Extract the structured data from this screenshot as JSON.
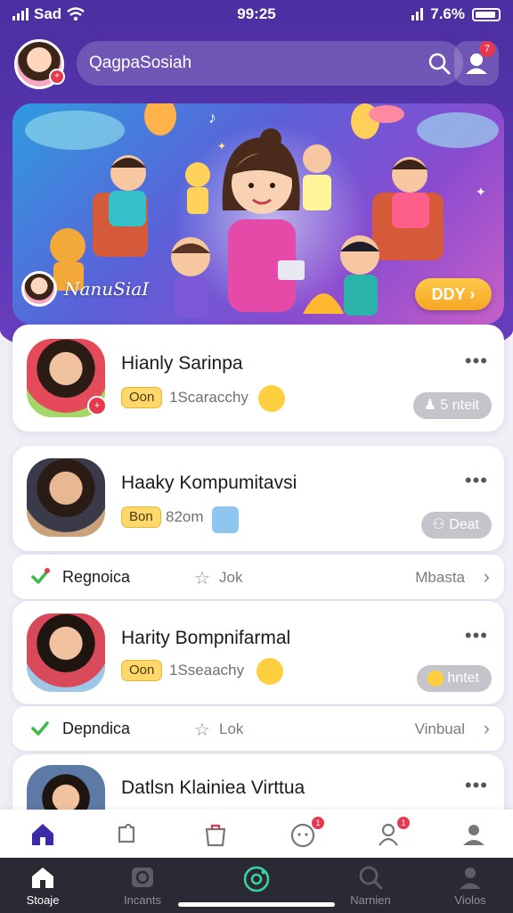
{
  "status": {
    "carrier": "Sad",
    "time": "99:25",
    "battery": "7.6%"
  },
  "header": {
    "search_placeholder": "QagpaSosiah",
    "profile_badge": "7",
    "avatar_badge": "+"
  },
  "hero": {
    "caption": "NanuSiaI",
    "cta_label": "DDY ›"
  },
  "cards": [
    {
      "name": "Hianly Sarinpa",
      "tag": "Oon",
      "sub": "1Scaracchy",
      "pill": "5 nteit",
      "more": "•••"
    },
    {
      "name": "Haaky Kompumitavsi",
      "tag": "Bon",
      "sub": "82om",
      "pill": "Deat",
      "more": "•••"
    },
    {
      "name": "Harity Bompnifarmal",
      "tag": "Oon",
      "sub": "1Sseaachy",
      "pill": "hntet",
      "more": "•••"
    },
    {
      "name": "Datlsn Klainiea Virttua",
      "more": "•••"
    }
  ],
  "rows": [
    {
      "label": "Regnoica",
      "mid": "Jok",
      "right": "Mbasta"
    },
    {
      "label": "Depndica",
      "mid": "Lok",
      "right": "Vinbual"
    }
  ],
  "nav_top_badges": {
    "chat": "1",
    "people": "1"
  },
  "nav": [
    {
      "label": "Stoaje"
    },
    {
      "label": "Incants"
    },
    {
      "label": ""
    },
    {
      "label": "Narnien"
    },
    {
      "label": "Violos"
    }
  ],
  "colors": {
    "primary": "#4b2fa0",
    "accent": "#f5a623",
    "badge": "#e53950",
    "check": "#3cba4a"
  }
}
